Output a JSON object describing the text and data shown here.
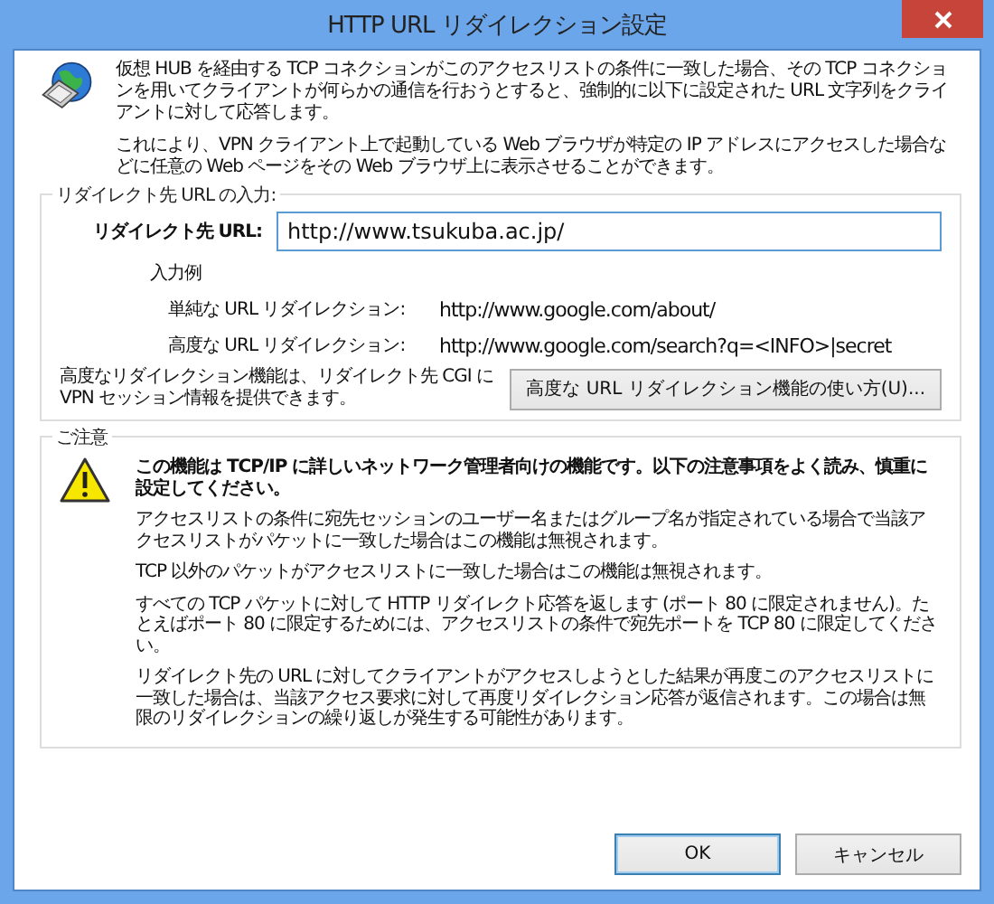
{
  "window": {
    "title": "HTTP URL リダイレクション設定"
  },
  "intro": [
    "仮想 HUB を経由する TCP コネクションがこのアクセスリストの条件に一致した場合、その TCP コネクションを用いてクライアントが何らかの通信を行おうとすると、強制的に以下に設定された URL 文字列をクライアントに対して応答します。",
    "これにより、VPN クライアント上で起動している Web ブラウザが特定の IP アドレスにアクセスした場合などに任意の Web ページをその Web ブラウザ上に表示させることができます。"
  ],
  "url_group": {
    "legend": "リダイレクト先 URL の入力:",
    "field_label": "リダイレクト先 URL:",
    "value": "http://www.tsukuba.ac.jp/",
    "examples_title": "入力例",
    "examples": [
      {
        "label": "単純な URL リダイレクション:",
        "value": "http://www.google.com/about/"
      },
      {
        "label": "高度な URL リダイレクション:",
        "value": "http://www.google.com/search?q=<INFO>|secret"
      }
    ],
    "note": "高度なリダイレクション機能は、リダイレクト先 CGI に VPN セッション情報を提供できます。",
    "help_button": "高度な URL リダイレクション機能の使い方(U)..."
  },
  "notice_group": {
    "legend": "ご注意",
    "warning": "この機能は TCP/IP に詳しいネットワーク管理者向けの機能です。以下の注意事項をよく読み、慎重に設定してください。",
    "paragraphs": [
      "アクセスリストの条件に宛先セッションのユーザー名またはグループ名が指定されている場合で当該アクセスリストがパケットに一致した場合はこの機能は無視されます。",
      "TCP 以外のパケットがアクセスリストに一致した場合はこの機能は無視されます。",
      "すべての TCP パケットに対して HTTP リダイレクト応答を返します (ポート 80 に限定されません)。たとえばポート 80 に限定するためには、アクセスリストの条件で宛先ポートを TCP 80 に限定してください。",
      "リダイレクト先の URL に対してクライアントがアクセスしようとした結果が再度このアクセスリストに一致した場合は、当該アクセス要求に対して再度リダイレクション応答が返信されます。この場合は無限のリダイレクションの繰り返しが発生する可能性があります。"
    ]
  },
  "buttons": [
    {
      "label": "OK",
      "default": true
    },
    {
      "label": "キャンセル",
      "default": false
    }
  ]
}
